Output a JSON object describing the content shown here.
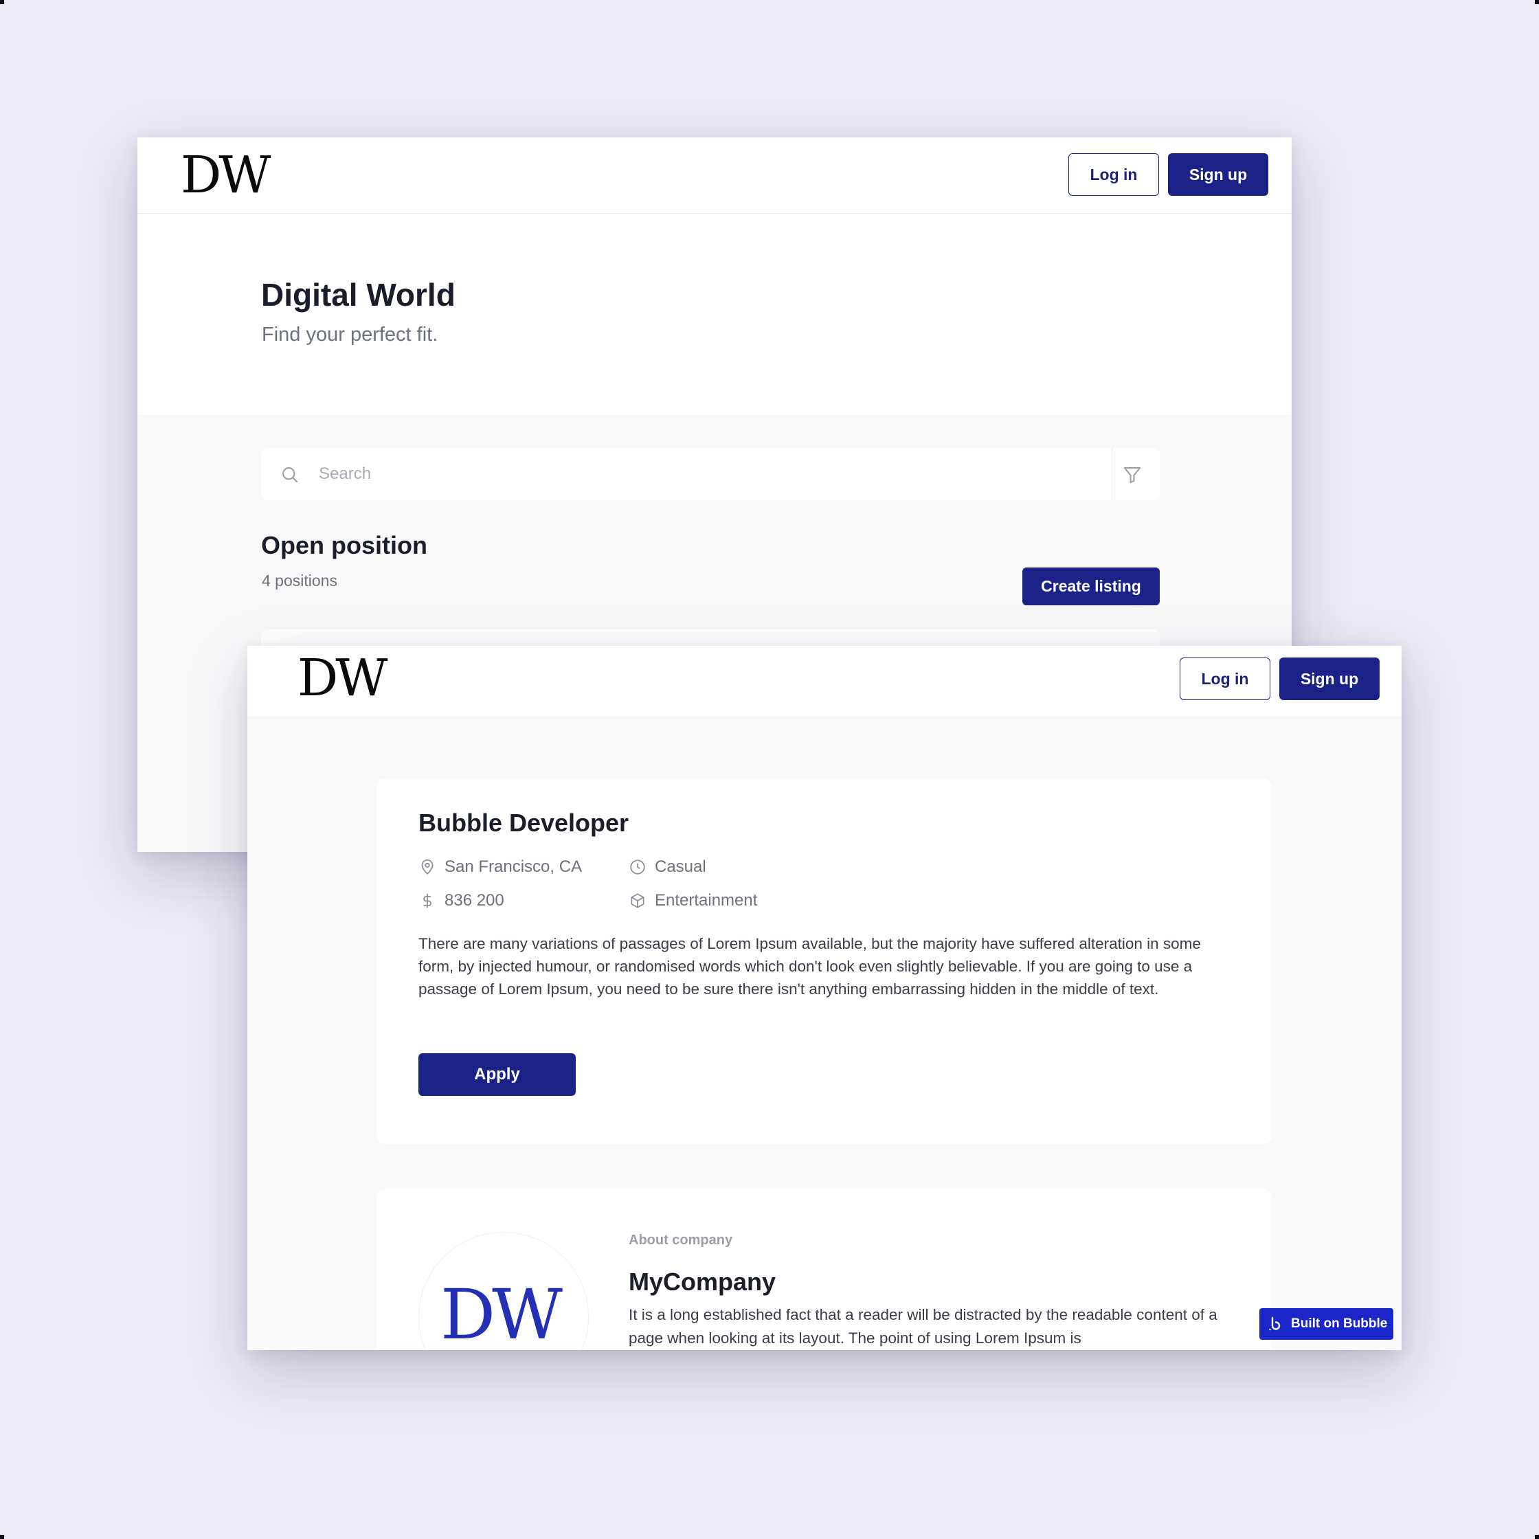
{
  "brand": {
    "logo_text": "DW",
    "accent_color": "#1a2288",
    "background_color": "#eceaf4"
  },
  "back_window": {
    "header": {
      "login_label": "Log in",
      "signup_label": "Sign up"
    },
    "hero": {
      "title": "Digital World",
      "subtitle": "Find your perfect fit."
    },
    "search": {
      "placeholder": "Search"
    },
    "positions": {
      "title": "Open position",
      "count_text": "4 positions",
      "create_label": "Create listing"
    }
  },
  "front_window": {
    "header": {
      "login_label": "Log in",
      "signup_label": "Sign up"
    },
    "job": {
      "title": "Bubble Developer",
      "location": "San Francisco, CA",
      "type": "Casual",
      "salary": "836 200",
      "category": "Entertainment",
      "description": "There are many variations of passages of Lorem Ipsum available, but the majority have suffered alteration in some form, by injected humour, or randomised words which don't look even slightly believable. If you are going to use a passage of Lorem Ipsum, you need to be sure there isn't anything embarrassing hidden in the middle of text.",
      "apply_label": "Apply"
    },
    "company": {
      "section_label": "About company",
      "name": "MyCompany",
      "logo_text": "DW",
      "description": "It is a long established fact that a reader will be distracted by the readable content of a page when looking at its layout. The point of using Lorem Ipsum is"
    },
    "badge": {
      "label": "Built on Bubble"
    }
  }
}
